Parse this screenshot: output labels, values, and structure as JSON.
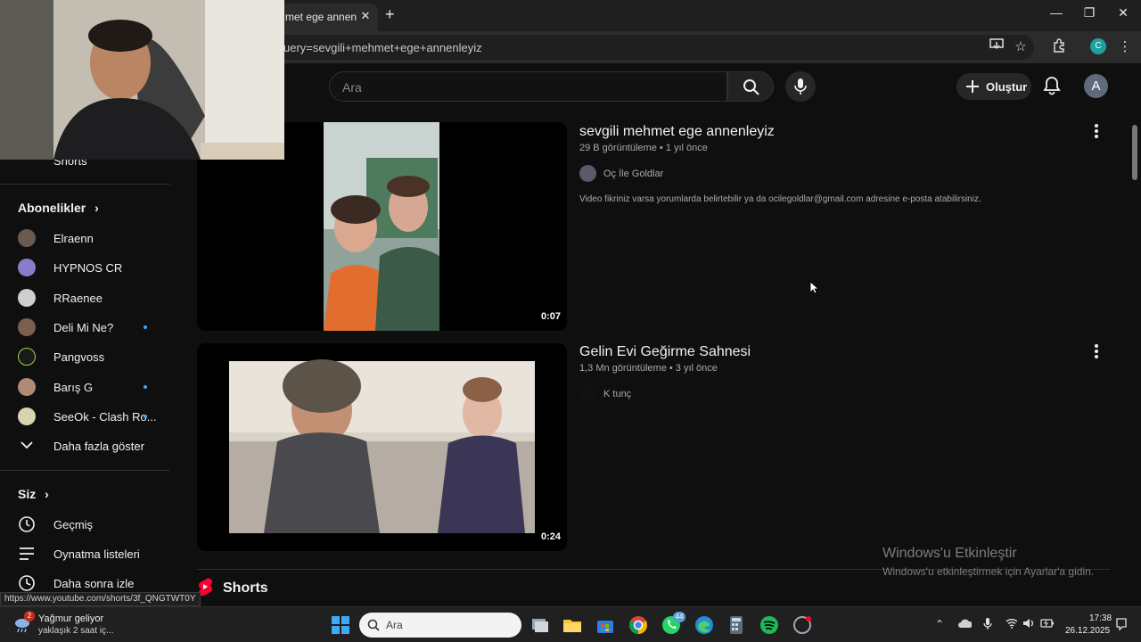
{
  "browser": {
    "tab_title": "met ege annenleyiz",
    "tab_close": "✕",
    "new_tab": "+",
    "url": "uery=sevgili+mehmet+ege+annenleyiz",
    "window_controls": [
      "—",
      "❐",
      "✕"
    ],
    "profile_initial": "C"
  },
  "header": {
    "search_placeholder": "Ara",
    "create_label": "Oluştur",
    "avatar_initial": "A"
  },
  "sidebar": {
    "shorts_label": "Shorts",
    "subscriptions_title": "Abonelikler",
    "subscriptions": [
      {
        "label": "Elraenn",
        "color": "#6b5a4e",
        "new": false
      },
      {
        "label": "HYPNOS CR",
        "color": "#8a7cc8",
        "new": false
      },
      {
        "label": "RRaenee",
        "color": "#cfcfcf",
        "new": false
      },
      {
        "label": "Deli Mi Ne?",
        "color": "#7a5f4d",
        "new": true
      },
      {
        "label": "Pangvoss",
        "color": "#1a1a1a",
        "new": false
      },
      {
        "label": "Barış G",
        "color": "#b08a74",
        "new": true
      },
      {
        "label": "SeeOk - Clash Ro...",
        "color": "#d9d4b0",
        "new": true
      }
    ],
    "show_more": "Daha fazla göster",
    "you_title": "Siz",
    "you_items": [
      {
        "label": "Geçmiş",
        "icon": "history-icon"
      },
      {
        "label": "Oynatma listeleri",
        "icon": "playlist-icon"
      },
      {
        "label": "Daha sonra izle",
        "icon": "watch-later-icon"
      }
    ]
  },
  "results": [
    {
      "title": "sevgili mehmet ege annenleyiz",
      "meta": "29 B görüntüleme • 1 yıl önce",
      "channel": "Oç İle Goldlar",
      "description": "Video fikriniz varsa yorumlarda belirtebilir ya da ocilegoldlar@gmail.com adresine e-posta atabilirsiniz.",
      "duration": "0:07"
    },
    {
      "title": "Gelin Evi Geğirme Sahnesi",
      "meta": "1,3 Mn görüntüleme • 3 yıl önce",
      "channel": "K tunç",
      "duration": "0:24"
    }
  ],
  "shorts_title": "Shorts",
  "status_url": "https://www.youtube.com/shorts/3f_QNGTWT0Y",
  "watermark": {
    "title": "Windows'u Etkinleştir",
    "subtitle": "Windows'u etkinleştirmek için Ayarlar'a gidin."
  },
  "taskbar": {
    "weather_title": "Yağmur geliyor",
    "weather_sub": "yaklaşık 2 saat iç...",
    "weather_badge": "2",
    "search_placeholder": "Ara",
    "whatsapp_badge": "44",
    "time": "17:38",
    "date": "26.12.2025"
  }
}
